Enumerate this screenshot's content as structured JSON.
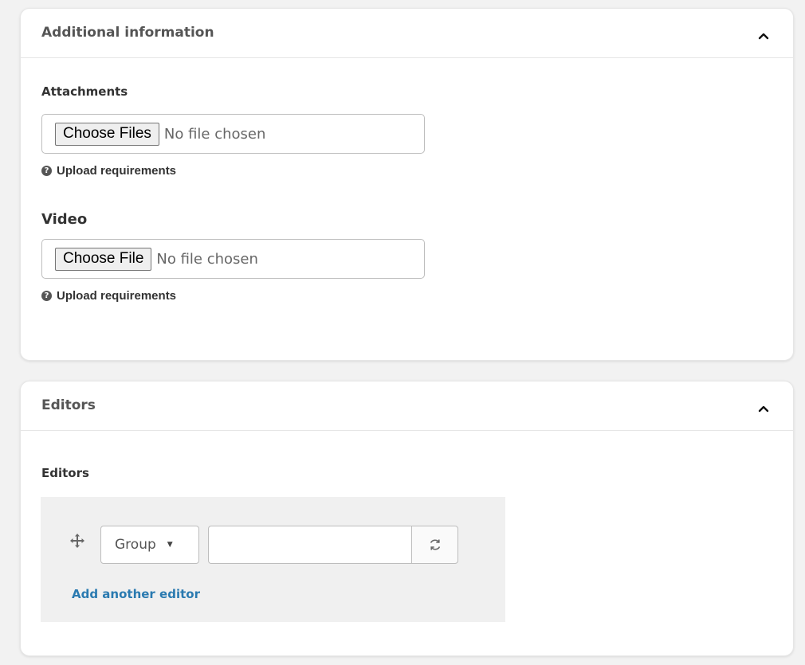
{
  "additional_info": {
    "title": "Additional information",
    "attachments": {
      "label": "Attachments",
      "button_label": "Choose Files",
      "status": "No file chosen",
      "requirements_label": "Upload requirements"
    },
    "video": {
      "label": "Video",
      "button_label": "Choose File",
      "status": "No file chosen",
      "requirements_label": "Upload requirements"
    }
  },
  "editors_section": {
    "title": "Editors",
    "field_label": "Editors",
    "select_value": "Group",
    "input_value": "",
    "add_label": "Add another editor"
  },
  "icons": {
    "collapse": "chevron-up-icon",
    "help": "question-circle-icon",
    "drag": "move-arrows-icon",
    "refresh": "refresh-icon",
    "caret": "caret-down-icon"
  },
  "colors": {
    "link": "#2a7ab0",
    "panel_bg": "#f0f0f0",
    "page_bg": "#f2f2f2"
  }
}
